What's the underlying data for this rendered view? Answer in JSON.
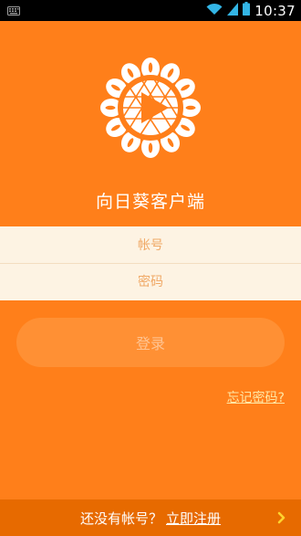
{
  "status_bar": {
    "time": "10:37",
    "icons": [
      "keyboard-icon",
      "wifi-icon",
      "cell-signal-icon",
      "battery-icon"
    ]
  },
  "app": {
    "title": "向日葵客户端",
    "logo_icon": "sunflower-play-logo"
  },
  "form": {
    "account_placeholder": "帐号",
    "password_placeholder": "密码",
    "login_label": "登录",
    "forgot_label": "忘记密码?"
  },
  "footer": {
    "prompt": "还没有帐号？",
    "register_label": "立即注册",
    "arrow_icon": "chevron-right-icon"
  },
  "colors": {
    "background": "#ff7f1a",
    "form_panel": "#fdf3e3",
    "button": "#ff9034",
    "footer": "#e76a00",
    "link": "#ffe7a5",
    "chevron": "#ffd22e"
  }
}
